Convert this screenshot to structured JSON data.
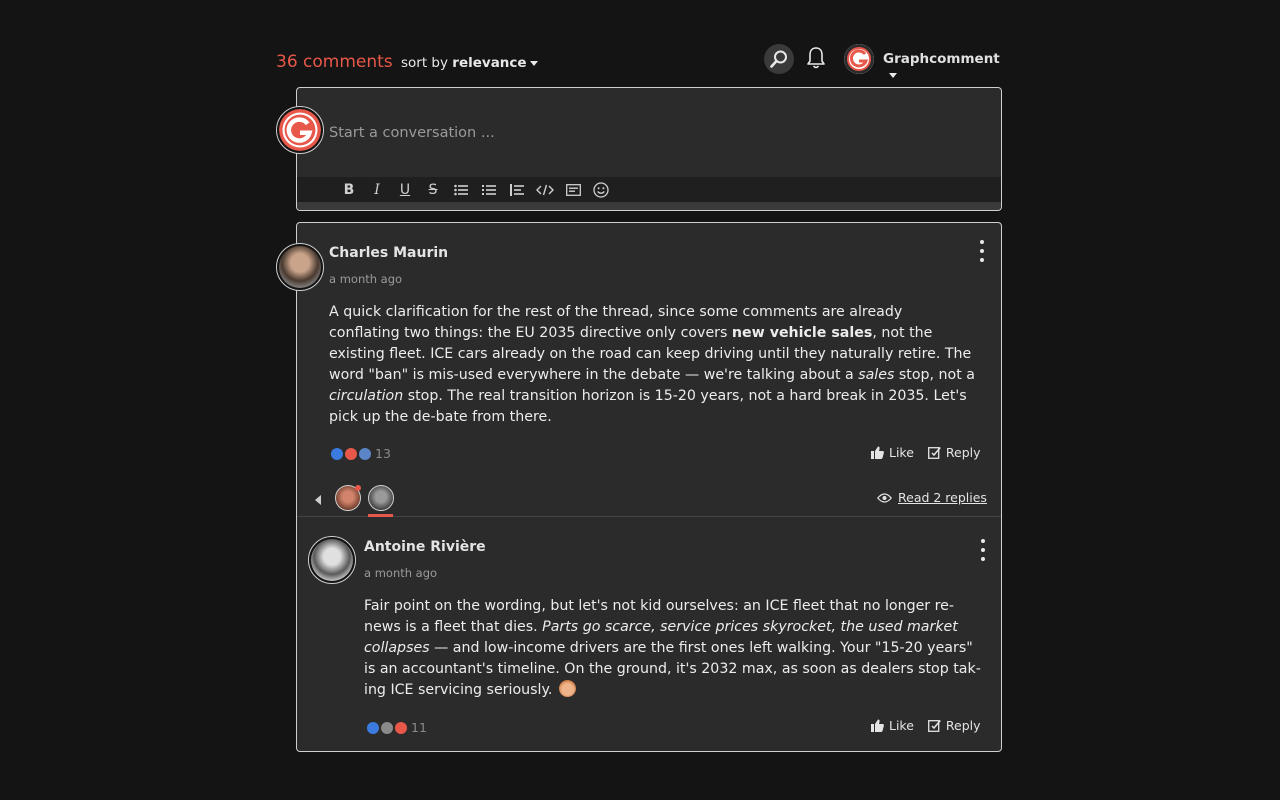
{
  "header": {
    "count": "36 comments",
    "sort_prefix": "sort by",
    "sort_value": "relevance",
    "user_name": "Graphcomment",
    "brand_color": "#e8584a"
  },
  "composer": {
    "placeholder": "Start a conversation ...",
    "toolbar": [
      "bold-icon",
      "italic-icon",
      "underline-icon",
      "strikethrough-icon",
      "bullet-list-icon",
      "numbered-list-icon",
      "blockquote-icon",
      "code-icon",
      "spoiler-icon",
      "emoji-icon"
    ]
  },
  "comments": [
    {
      "author": "Charles Maurin",
      "date": "a month ago",
      "body_parts": [
        {
          "t": "A quick clarification for the rest of the thread, since some comments are already conflating two things: the EU 2035 directive only covers "
        },
        {
          "t": "new vehicle sales",
          "b": true
        },
        {
          "t": ", not the existing fleet. ICE cars already on the road can keep driving until they naturally retire. The word \"ban\" is mis-used everywhere in the debate — we're talking about a "
        },
        {
          "t": "sales",
          "i": true
        },
        {
          "t": " stop, not a "
        },
        {
          "t": "circulation",
          "i": true
        },
        {
          "t": " stop. The real transition horizon is 15-20 years, not a hard break in 2035. Let's pick up the de-bate from there."
        }
      ],
      "reaction_count": "13",
      "like_label": "Like",
      "reply_label": "Reply",
      "read_replies": "Read 2 replies"
    },
    {
      "author": "Antoine Rivière",
      "date": "a month ago",
      "body_parts": [
        {
          "t": "Fair point on the wording, but let's not kid ourselves: an ICE fleet that no longer re-news is a fleet that dies. "
        },
        {
          "t": "Parts go scarce, service prices skyrocket, the used market collapses",
          "i": true
        },
        {
          "t": " — and low-income drivers are the first ones left walking. Your \"15-20 years\" is an accountant's timeline. On the ground, it's 2032 max, as soon as dealers stop tak-ing ICE servicing seriously. "
        }
      ],
      "reaction_count": "11",
      "like_label": "Like",
      "reply_label": "Reply"
    }
  ]
}
